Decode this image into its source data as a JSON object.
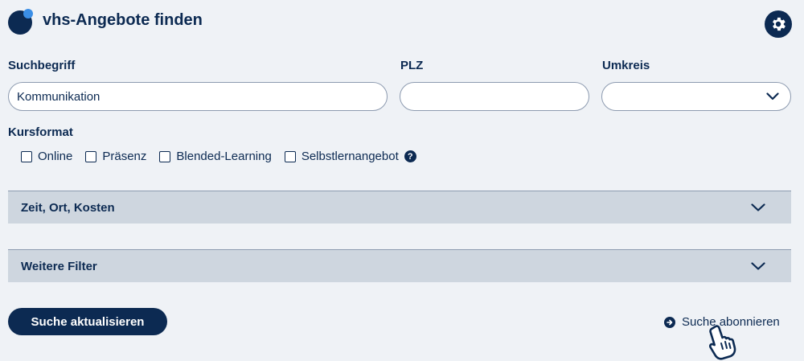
{
  "header": {
    "title": "vhs-Angebote finden",
    "logo_icon": "vhs-circle-logo-icon",
    "settings_icon": "gear-icon"
  },
  "search": {
    "term_label": "Suchbegriff",
    "term_value": "Kommunikation",
    "plz_label": "PLZ",
    "plz_value": "",
    "radius_label": "Umkreis",
    "radius_value": ""
  },
  "kursformat": {
    "label": "Kursformat",
    "options": [
      {
        "label": "Online",
        "checked": false
      },
      {
        "label": "Präsenz",
        "checked": false
      },
      {
        "label": "Blended-Learning",
        "checked": false
      },
      {
        "label": "Selbstlernangebot",
        "checked": false
      }
    ],
    "help_icon": "question-circle-icon"
  },
  "accordions": [
    {
      "label": "Zeit, Ort, Kosten",
      "icon": "chevron-down-icon"
    },
    {
      "label": "Weitere Filter",
      "icon": "chevron-down-icon"
    }
  ],
  "actions": {
    "update_label": "Suche aktualisieren",
    "subscribe_label": "Suche abonnieren",
    "subscribe_icon": "arrow-right-circle-icon"
  },
  "colors": {
    "primary": "#0c2a52",
    "accent": "#3a8ee6",
    "background": "#eff2f6",
    "accordion_bg": "#ced6df"
  }
}
